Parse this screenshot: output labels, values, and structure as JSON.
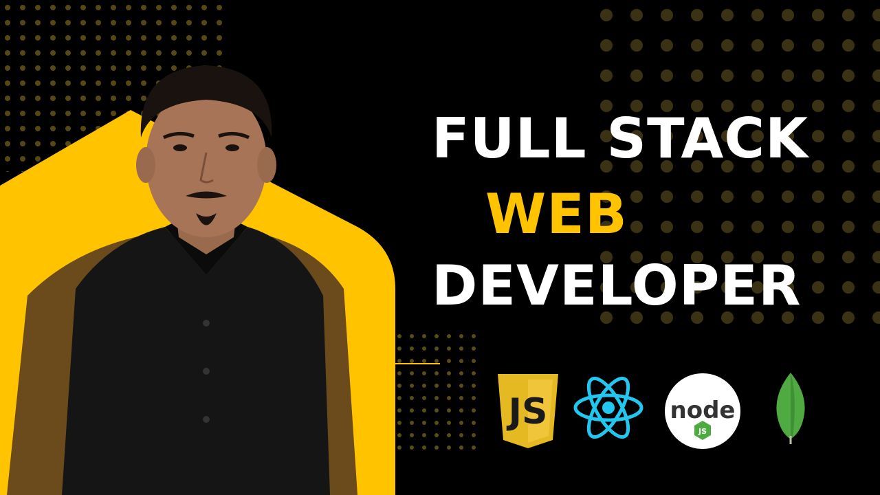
{
  "headline": {
    "line1": "FULL STACK",
    "line2": "WEB",
    "line3": "DEVELOPER"
  },
  "tech_logos": [
    {
      "name": "javascript-icon",
      "label": "JS"
    },
    {
      "name": "react-icon"
    },
    {
      "name": "nodejs-icon",
      "label": "node",
      "sub": "JS"
    },
    {
      "name": "mongodb-icon"
    }
  ],
  "colors": {
    "background": "#000000",
    "accent": "#ffc300",
    "text": "#ffffff",
    "react": "#22c7f0",
    "mongodb": "#4faa41",
    "js_shield": "#e4b921"
  }
}
